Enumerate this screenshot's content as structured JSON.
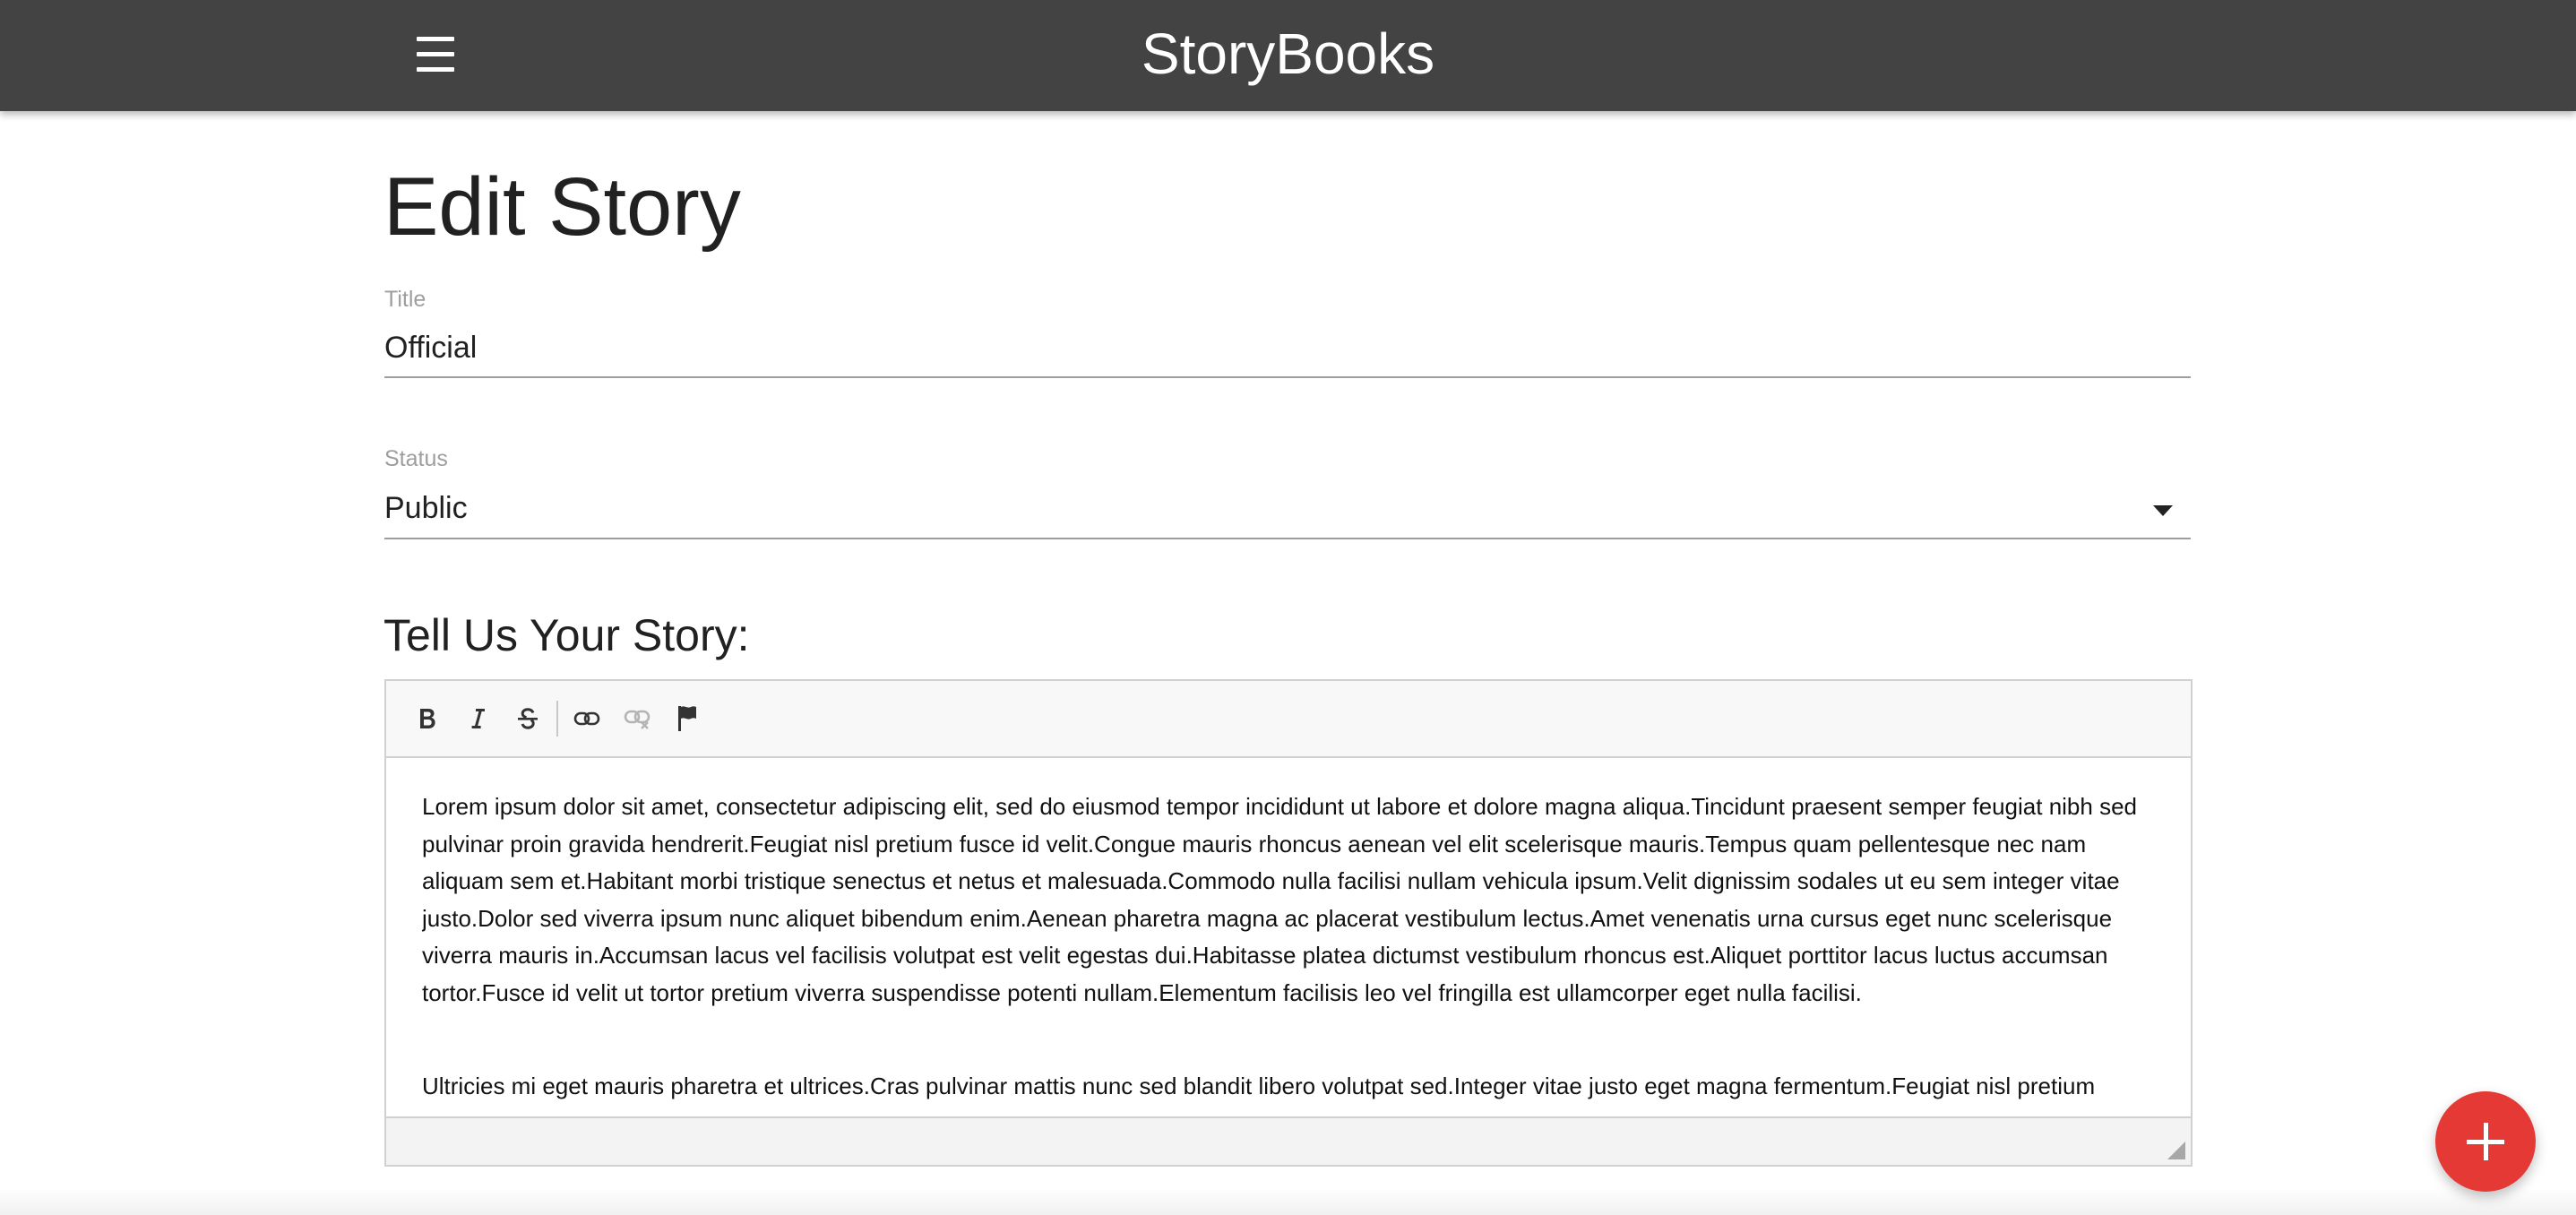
{
  "navbar": {
    "brand": "StoryBooks",
    "menu_icon": "hamburger-menu-icon",
    "background": "#434343"
  },
  "page": {
    "title": "Edit Story"
  },
  "form": {
    "title_label": "Title",
    "title_value": "Official",
    "status_label": "Status",
    "status_value": "Public",
    "story_heading": "Tell Us Your Story:"
  },
  "editor": {
    "toolbar": [
      {
        "name": "bold",
        "icon": "bold-icon"
      },
      {
        "name": "italic",
        "icon": "italic-icon"
      },
      {
        "name": "strikethrough",
        "icon": "strikethrough-icon"
      },
      {
        "name": "link",
        "icon": "link-icon"
      },
      {
        "name": "unlink",
        "icon": "unlink-icon"
      },
      {
        "name": "anchor",
        "icon": "flag-icon"
      }
    ],
    "paragraphs": [
      "Lorem ipsum dolor sit amet, consectetur adipiscing elit, sed do eiusmod tempor incididunt ut labore et dolore magna aliqua.Tincidunt praesent semper feugiat nibh sed pulvinar proin gravida hendrerit.Feugiat nisl pretium fusce id velit.Congue mauris rhoncus aenean vel elit scelerisque mauris.Tempus quam pellentesque nec nam aliquam sem et.Habitant morbi tristique senectus et netus et malesuada.Commodo nulla facilisi nullam vehicula ipsum.Velit dignissim sodales ut eu sem integer vitae justo.Dolor sed viverra ipsum nunc aliquet bibendum enim.Aenean pharetra magna ac placerat vestibulum lectus.Amet venenatis urna cursus eget nunc scelerisque viverra mauris in.Accumsan lacus vel facilisis volutpat est velit egestas dui.Habitasse platea dictumst vestibulum rhoncus est.Aliquet porttitor lacus luctus accumsan tortor.Fusce id velit ut tortor pretium viverra suspendisse potenti nullam.Elementum facilisis leo vel fringilla est ullamcorper eget nulla facilisi.",
      "Ultricies mi eget mauris pharetra et ultrices.Cras pulvinar mattis nunc sed blandit libero volutpat sed.Integer vitae justo eget magna fermentum.Feugiat nisl pretium"
    ]
  },
  "fab": {
    "icon": "plus-icon",
    "color": "#e53935"
  }
}
